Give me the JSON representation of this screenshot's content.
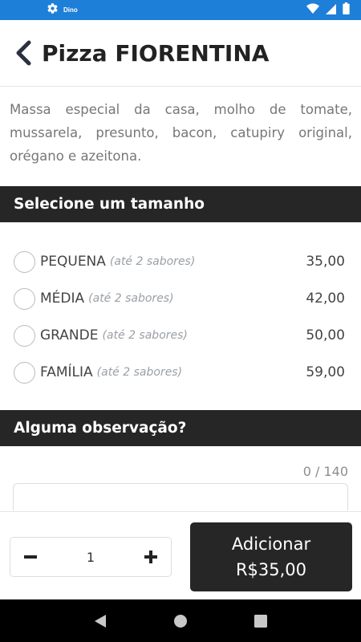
{
  "status_bar": {
    "icons": [
      "settings-icon",
      "wifi-icon",
      "signal-icon",
      "battery-icon"
    ],
    "small_label": "Dino",
    "background": "#1e7fd8"
  },
  "header": {
    "title": "Pizza FIORENTINA",
    "back_icon": "chevron-left-icon"
  },
  "description": "Massa especial da casa, molho de tomate, mussarela, presunto, bacon, catupiry original, orégano e azeitona.",
  "size_section": {
    "title": "Selecione um tamanho",
    "options": [
      {
        "name": "PEQUENA",
        "note": "(até 2 sabores)",
        "price": "35,00",
        "selected": false
      },
      {
        "name": "MÉDIA",
        "note": "(até 2 sabores)",
        "price": "42,00",
        "selected": false
      },
      {
        "name": "GRANDE",
        "note": "(até 2 sabores)",
        "price": "50,00",
        "selected": false
      },
      {
        "name": "FAMÍLIA",
        "note": "(até 2 sabores)",
        "price": "59,00",
        "selected": false
      }
    ]
  },
  "observation_section": {
    "title": "Alguma observação?",
    "char_count": "0 / 140",
    "value": ""
  },
  "footer": {
    "quantity": "1",
    "minus_icon": "minus-icon",
    "plus_icon": "plus-icon",
    "add_label": "Adicionar",
    "add_price": "R$35,00",
    "button_color": "#262626"
  },
  "nav_bar": {
    "icons": [
      "back-triangle-icon",
      "home-circle-icon",
      "recents-square-icon"
    ]
  }
}
